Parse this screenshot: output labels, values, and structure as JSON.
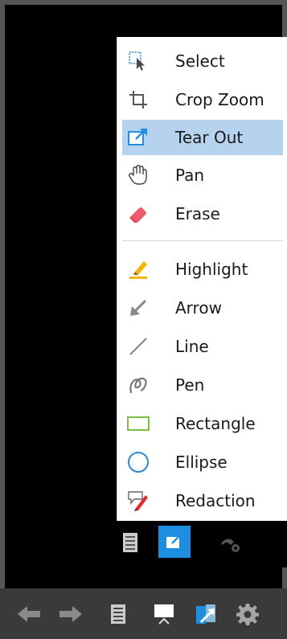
{
  "menu": {
    "items": [
      {
        "label": "Select",
        "icon": "cursor-select-icon"
      },
      {
        "label": "Crop Zoom",
        "icon": "crop-icon"
      },
      {
        "label": "Tear Out",
        "icon": "tear-out-icon",
        "selected": true
      },
      {
        "label": "Pan",
        "icon": "hand-icon"
      },
      {
        "label": "Erase",
        "icon": "eraser-icon"
      },
      {
        "label": "Highlight",
        "icon": "highlighter-icon"
      },
      {
        "label": "Arrow",
        "icon": "arrow-icon"
      },
      {
        "label": "Line",
        "icon": "line-icon"
      },
      {
        "label": "Pen",
        "icon": "pen-icon"
      },
      {
        "label": "Rectangle",
        "icon": "rectangle-icon"
      },
      {
        "label": "Ellipse",
        "icon": "ellipse-icon"
      },
      {
        "label": "Redaction",
        "icon": "redaction-icon"
      }
    ]
  },
  "colors": {
    "selected_bg": "#b5d3ee",
    "accent_blue": "#1e8fe0",
    "toolbar_bg": "#3a3a3a"
  }
}
